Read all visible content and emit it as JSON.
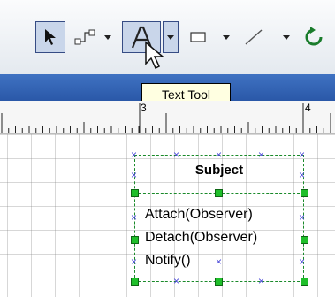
{
  "toolbar": {
    "tools": [
      {
        "name": "pointer-tool",
        "icon": "pointer-arrow-icon"
      },
      {
        "name": "connector-tool",
        "icon": "connector-icon"
      },
      {
        "name": "text-tool",
        "icon": "text-a-icon",
        "pressed": true
      },
      {
        "name": "rectangle-tool",
        "icon": "rectangle-icon"
      },
      {
        "name": "line-tool",
        "icon": "line-icon"
      },
      {
        "name": "rotate-tool",
        "icon": "rotate-icon"
      }
    ]
  },
  "tooltip": {
    "text": "Text Tool"
  },
  "ruler": {
    "marks": [
      "3",
      "4"
    ]
  },
  "uml_class": {
    "name": "Subject",
    "methods": [
      "Attach(Observer)",
      "Detach(Observer)",
      "Notify()"
    ]
  },
  "colors": {
    "band": "#2f5fb0",
    "selection": "#1fbf2a",
    "connection_points": "#4a48d8"
  }
}
